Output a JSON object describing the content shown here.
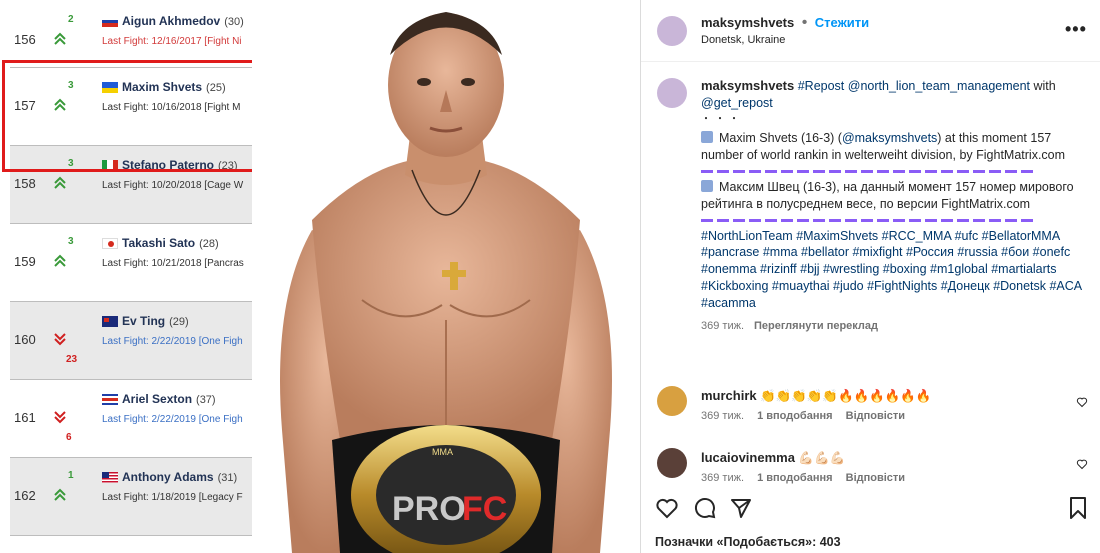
{
  "rankings": [
    {
      "rank": "",
      "move": "2",
      "direction": "up",
      "flag": "ru",
      "name": "Aigun Akhmedov",
      "age": "(30)",
      "last_fight": "Last Fight: 12/16/2017 [Fight Ni",
      "fight_color": "red",
      "shade": false,
      "rank_visible": "156"
    },
    {
      "rank": "157",
      "move": "3",
      "direction": "up",
      "flag": "ua",
      "name": "Maxim Shvets",
      "age": "(25)",
      "last_fight": "Last Fight: 10/16/2018 [Fight M",
      "fight_color": "normal",
      "shade": false
    },
    {
      "rank": "158",
      "move": "3",
      "direction": "up",
      "flag": "it",
      "name": "Stefano Paterno",
      "age": "(23)",
      "last_fight": "Last Fight: 10/20/2018 [Cage W",
      "fight_color": "normal",
      "shade": true
    },
    {
      "rank": "159",
      "move": "3",
      "direction": "up",
      "flag": "jp",
      "name": "Takashi Sato",
      "age": "(28)",
      "last_fight": "Last Fight: 10/21/2018 [Pancras",
      "fight_color": "normal",
      "shade": false
    },
    {
      "rank": "160",
      "move": "23",
      "direction": "down",
      "flag": "nz",
      "name": "Ev Ting",
      "age": "(29)",
      "last_fight": "Last Fight: 2/22/2019 [One Figh",
      "fight_color": "blue",
      "shade": true
    },
    {
      "rank": "161",
      "move": "6",
      "direction": "down",
      "flag": "cr",
      "name": "Ariel Sexton",
      "age": "(37)",
      "last_fight": "Last Fight: 2/22/2019 [One Figh",
      "fight_color": "blue",
      "shade": false
    },
    {
      "rank": "162",
      "move": "1",
      "direction": "up",
      "flag": "us",
      "name": "Anthony Adams",
      "age": "(31)",
      "last_fight": "Last Fight: 1/18/2019 [Legacy F",
      "fight_color": "normal",
      "shade": true
    }
  ],
  "photo": {
    "belt_text_pro": "PRO",
    "belt_text_fc": "FC",
    "belt_small": "MMA"
  },
  "post": {
    "username": "maksymshvets",
    "dot": "•",
    "follow_label": "Стежити",
    "location": "Donetsk, Ukraine",
    "more_label": "•••",
    "caption_user": "maksymshvets",
    "caption_l1_tag": "#Repost",
    "caption_l1_mention": "@north_lion_team_management",
    "caption_l1_with": "with",
    "caption_l2_mention": "@get_repost",
    "caption_dots": "・・・",
    "en_text_a": "Maxim Shvets (16-3) (",
    "en_mention": "@maksymshvets",
    "en_text_b": ") at this moment 157 number of world rankin in welterweiht division, by FightMatrix.com",
    "ru_text": "Максим Швец (16-3), на данный момент 157 номер мирового рейтинга в полусреднем весе, по версии FightMatrix.com",
    "hashtags": "#NorthLionTeam #MaximShvets #RCC_MMA #ufc #BellatorMMA #pancrase #mma #bellator #mixfight #Россия #russia #бои #onefc #onemma #rizinff #bjj #wrestling #boxing #m1global #martialarts #Kickboxing #muaythai #judo #FightNights #Донецк #Donetsk #ACA #acamma",
    "caption_age": "369 тиж.",
    "see_translation": "Переглянути переклад",
    "comments": [
      {
        "user": "murchirk",
        "emoji": "👏👏👏👏👏🔥🔥🔥🔥🔥🔥",
        "age": "369 тиж.",
        "likes": "1 вподобання",
        "reply": "Відповісти"
      },
      {
        "user": "lucaiovinemma",
        "emoji": "💪🏻💪🏻💪🏻",
        "age": "369 тиж.",
        "likes": "1 вподобання",
        "reply": "Відповісти"
      }
    ],
    "likes_label": "Позначки «Подобається»: 403"
  }
}
